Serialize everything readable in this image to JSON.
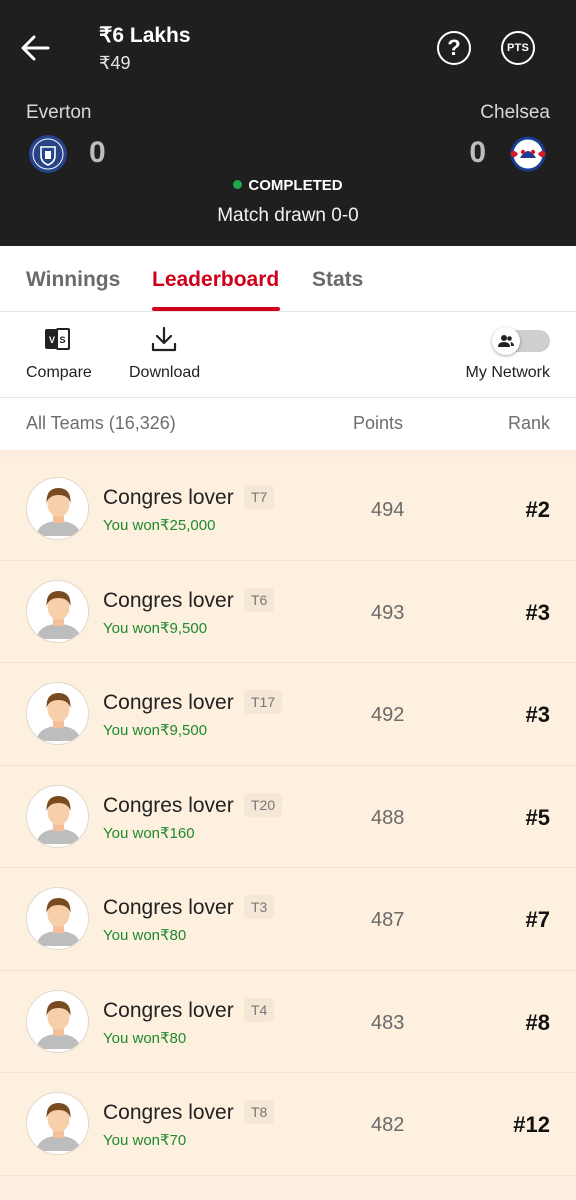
{
  "header": {
    "prize": "₹6 Lakhs",
    "entry_fee": "₹49",
    "help_label": "?",
    "pts_label": "PTS",
    "home_team": {
      "name": "Everton",
      "score": "0",
      "crest_icon": "everton-crest-icon"
    },
    "away_team": {
      "name": "Chelsea",
      "score": "0",
      "crest_icon": "chelsea-crest-icon"
    },
    "status": "COMPLETED",
    "status_color": "#1fa84a",
    "result": "Match drawn 0-0"
  },
  "tabs": [
    {
      "label": "Winnings",
      "active": false
    },
    {
      "label": "Leaderboard",
      "active": true
    },
    {
      "label": "Stats",
      "active": false
    }
  ],
  "toolbar": {
    "compare_label": "Compare",
    "download_label": "Download",
    "network_label": "My Network",
    "network_toggle_on": false
  },
  "list_header": {
    "teams_label": "All Teams (16,326)",
    "points_label": "Points",
    "rank_label": "Rank"
  },
  "rows": [
    {
      "name": "Congres lover",
      "tag": "T7",
      "won": "You won₹25,000",
      "points": "494",
      "rank": "#2"
    },
    {
      "name": "Congres lover",
      "tag": "T6",
      "won": "You won₹9,500",
      "points": "493",
      "rank": "#3"
    },
    {
      "name": "Congres lover",
      "tag": "T17",
      "won": "You won₹9,500",
      "points": "492",
      "rank": "#3"
    },
    {
      "name": "Congres lover",
      "tag": "T20",
      "won": "You won₹160",
      "points": "488",
      "rank": "#5"
    },
    {
      "name": "Congres lover",
      "tag": "T3",
      "won": "You won₹80",
      "points": "487",
      "rank": "#7"
    },
    {
      "name": "Congres lover",
      "tag": "T4",
      "won": "You won₹80",
      "points": "483",
      "rank": "#8"
    },
    {
      "name": "Congres lover",
      "tag": "T8",
      "won": "You won₹70",
      "points": "482",
      "rank": "#12"
    }
  ],
  "colors": {
    "accent": "#d0001b",
    "header_bg": "#1f1f1f",
    "row_bg": "#fdf0df",
    "won_text": "#1f8a2e"
  }
}
